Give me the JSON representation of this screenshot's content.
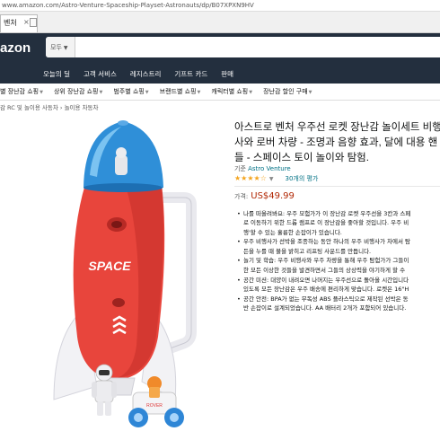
{
  "browser": {
    "url": "www.amazon.com/Astro-Venture-Spaceship-Playset-Astronauts/dp/B07XPXN9HV",
    "tab_title": "벤처",
    "tab_close": "×"
  },
  "header": {
    "logo": "azon",
    "search_category": "모두",
    "nav_links": [
      "오늘의 딜",
      "고객 서비스",
      "레지스트리",
      "기프트 카드",
      "판매"
    ]
  },
  "subnav": {
    "items": [
      "별 장난감 쇼핑",
      "상위 장난감 쇼핑",
      "범주별 쇼핑",
      "브랜드별 쇼핑",
      "캐릭터별 쇼핑",
      "장난감 할인 구매"
    ]
  },
  "breadcrumb": "감 RC 및 놀이용 사동차 › 놀이용 차동차",
  "product": {
    "image_label": "SPACE",
    "rover_label": "ROVER",
    "title": "아스트로 벤처 우주선 로켓 장난감 놀이세트 비행사와 로버 차량 - 조명과 음향 효과, 달에 대용 핸들 - 스페이스 토이 놀이와 탐험.",
    "brand_prefix": "기준",
    "brand": "Astro Venture",
    "stars": "★★★★☆",
    "rating_count": "30개의 평가",
    "price_label": "가격:",
    "price": "US$49.99",
    "bullets": [
      [
        "나를 떠올려봐요: 우주 모험가가 이 장난감 로켓 우주선을 3칸과 스페",
        "로 이동하기 위한 드롭 램프로 이 장난감을 좋아할 것입니다. 우주 비",
        "행'할 수 있는 훌륭한 손잡이가 있습니다."
      ],
      [
        "우주 비행사가 선박을 조종하는 동안 하나의 우주 비행사가 차에서 탐",
        "든을 누를 때 불을 밝히고 리프팅 사운드를 만듭니다."
      ],
      [
        "놀기 및 학습: 우주 비행사와 우주 차량을 통해 우주 탐험가가 그들이",
        "한 모든 이상한 것들을 발견하면서 그들의 상상력을 야기하게 할 수 "
      ],
      [
        "공간 미션: 대양이 내려오면 나머지는 우주선으로 돌아올 시간입니다",
        "있도록 모든 장난감은 우주 배송에 편리하게 맞습니다. 로켓은 16\"H"
      ],
      [
        "공간 안전: BPA가 없는 무독성 ABS 플라스틱으로 제작된 선박은 동",
        "반 손잡이로 설계되었습니다. AA 배터리 2개가 포함되어 있습니다."
      ]
    ]
  },
  "colors": {
    "nav_bg": "#232f3e",
    "rocket_red": "#e8453c",
    "dome_blue": "#2f8fd8",
    "link": "#007185",
    "price": "#b12704",
    "star": "#f4a41d"
  }
}
